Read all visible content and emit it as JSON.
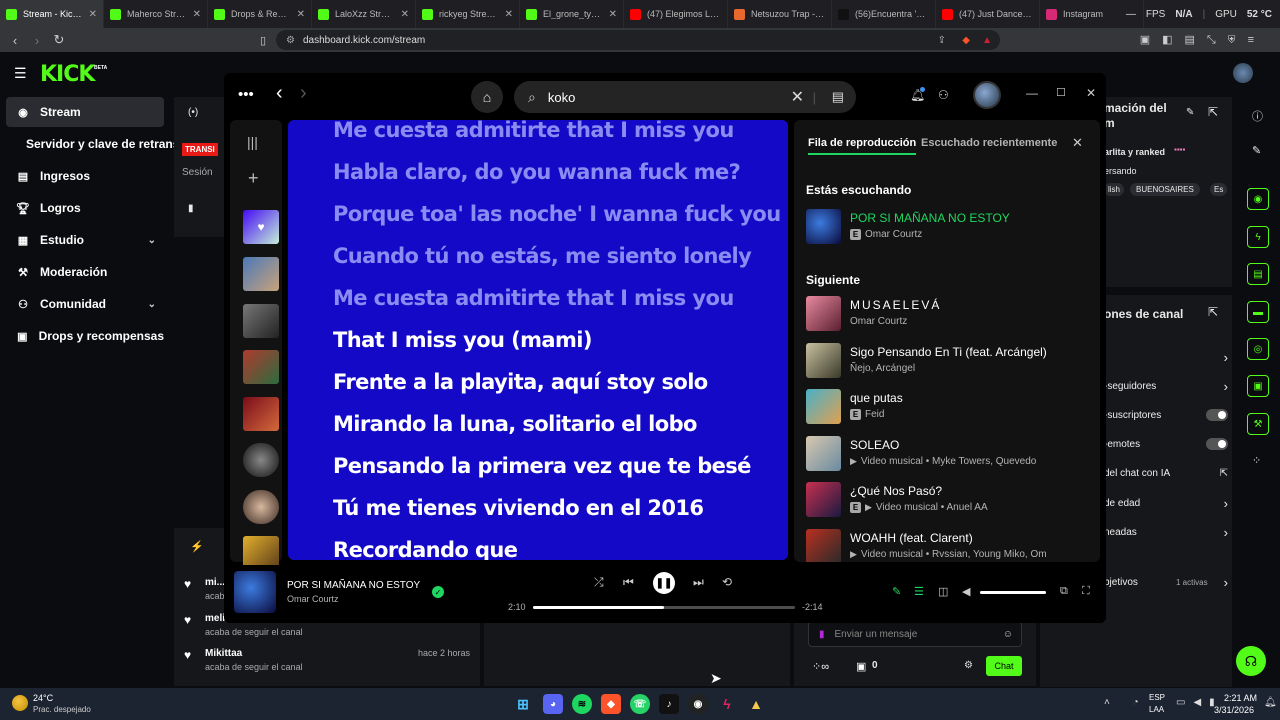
{
  "browser": {
    "tabs": [
      {
        "title": "Stream - Kick D",
        "color": "#53fc18",
        "active": true
      },
      {
        "title": "Maherco Stream - W",
        "color": "#53fc18"
      },
      {
        "title": "Drops & Rewards I",
        "color": "#53fc18"
      },
      {
        "title": "LaloXzz Stream - W",
        "color": "#53fc18"
      },
      {
        "title": "rickyeg Stream - Wa",
        "color": "#53fc18"
      },
      {
        "title": "El_grone_tyson Stre",
        "color": "#53fc18"
      },
      {
        "title": "(47) Elegimos LA M",
        "color": "#ff0000"
      },
      {
        "title": "Netsuzou Trap -NTR",
        "color": "#e8692e"
      },
      {
        "title": "(56)Encuentra 'clase",
        "color": "#111111"
      },
      {
        "title": "(47) Just Dance 201",
        "color": "#ff0000"
      },
      {
        "title": "Instagram",
        "color": "#d62976"
      }
    ],
    "fps_label": "FPS",
    "fps_value": "N/A",
    "gpu_label": "GPU",
    "gpu_value": "52 °C",
    "url": "dashboard.kick.com/stream"
  },
  "kick": {
    "logo": "KICK",
    "logo_badge": "BETA",
    "sidebar": [
      {
        "label": "Stream",
        "icon": "broadcast-icon",
        "active": true
      },
      {
        "label": "Servidor y clave de retransmisión",
        "icon": ""
      },
      {
        "label": "Ingresos",
        "icon": "money-icon"
      },
      {
        "label": "Logros",
        "icon": "trophy-icon"
      },
      {
        "label": "Estudio",
        "icon": "studio-icon",
        "chevron": true
      },
      {
        "label": "Moderación",
        "icon": "wrench-icon"
      },
      {
        "label": "Comunidad",
        "icon": "people-icon",
        "chevron": true
      },
      {
        "label": "Drops y recompensas",
        "icon": "gift-icon"
      }
    ],
    "transmit_badge": "TRANSI",
    "session_label": "Sesión",
    "info_title_1": "mación del",
    "info_title_2": "m",
    "info_lines": [
      "arlita y ranked",
      "ersando"
    ],
    "tags": [
      "lish",
      "BUENOSAIRES",
      "Es"
    ],
    "channel_options_title": "ones de canal",
    "channel_options": [
      {
        "label": "",
        "control": "chevron"
      },
      {
        "label": "-seguidores",
        "control": "chevron"
      },
      {
        "label": "-suscriptores",
        "control": "toggle"
      },
      {
        "label": "-emotes",
        "control": "toggle"
      },
      {
        "label": "del chat con IA",
        "control": "external"
      },
      {
        "label": "de edad",
        "control": "chevron"
      },
      {
        "label": "neadas",
        "control": "chevron"
      },
      {
        "label": "l",
        "control": "none"
      },
      {
        "label": "bjetivos",
        "control": "chevron",
        "extra": "1 activas"
      }
    ],
    "feed": [
      {
        "name": "mi...",
        "sub": "acaba",
        "time": ""
      },
      {
        "name": "meli",
        "sub": "acaba de seguir el canal",
        "time": ""
      },
      {
        "name": "Mikittaa",
        "sub": "acaba de seguir el canal",
        "time": "hace 2 horas"
      }
    ],
    "chat_placeholder": "Enviar un mensaje",
    "chat_button": "Chat",
    "chat_count": "0"
  },
  "spotify": {
    "search_value": "koko",
    "lyrics": [
      {
        "text": "Me cuesta admitirte that I miss you",
        "state": "past"
      },
      {
        "text": "Habla claro, do you wanna fuck me?",
        "state": "past"
      },
      {
        "text": "Porque toa' las noche' I wanna fuck you",
        "state": "past"
      },
      {
        "text": "Cuando tú no estás, me siento lonely",
        "state": "past"
      },
      {
        "text": "Me cuesta admitirte that I miss you",
        "state": "past"
      },
      {
        "text": "That I miss you (mami)",
        "state": "now"
      },
      {
        "text": "Frente a la playita, aquí stoy solo",
        "state": "next"
      },
      {
        "text": "Mirando la luna, solitario el lobo",
        "state": "next"
      },
      {
        "text": "Pensando la primera vez que te besé",
        "state": "next"
      },
      {
        "text": "Tú me tienes viviendo en el 2016",
        "state": "next"
      },
      {
        "text": "Recordando que",
        "state": "next"
      }
    ],
    "queue": {
      "tab_active": "Fila de reproducción",
      "tab_inactive": "Escuchado recientemente",
      "now_heading": "Estás escuchando",
      "now_title": "POR SI MAÑANA NO ESTOY",
      "now_artist": "Omar Courtz",
      "next_heading": "Siguiente",
      "items": [
        {
          "title": "MUSAELEVÁ",
          "artist": "Omar Courtz",
          "explicit": false,
          "video": false
        },
        {
          "title": "Sigo Pensando En Ti (feat. Arcángel)",
          "artist": "Ñejo, Arcángel",
          "explicit": false,
          "video": false
        },
        {
          "title": "que putas",
          "artist": "Feid",
          "explicit": true,
          "video": false
        },
        {
          "title": "SOLEAO",
          "artist": "Video musical • Myke Towers, Quevedo",
          "explicit": false,
          "video": true
        },
        {
          "title": "¿Qué Nos Pasó?",
          "artist": "Video musical • Anuel AA",
          "explicit": true,
          "video": true
        },
        {
          "title": "WOAHH (feat. Clarent)",
          "artist": "Video musical • Rvssian, Young Miko, Om",
          "explicit": false,
          "video": true
        }
      ]
    },
    "player": {
      "title": "POR SI MAÑANA NO ESTOY",
      "artist": "Omar Courtz",
      "elapsed": "2:10",
      "remaining": "-2:14",
      "progress": 0.5,
      "volume": 1.0
    }
  },
  "taskbar": {
    "weather_temp": "24°C",
    "weather_text": "Prac. despejado",
    "lang_top": "ESP",
    "lang_bottom": "LAA",
    "time": "2:21 AM",
    "date": "3/31/2026"
  }
}
